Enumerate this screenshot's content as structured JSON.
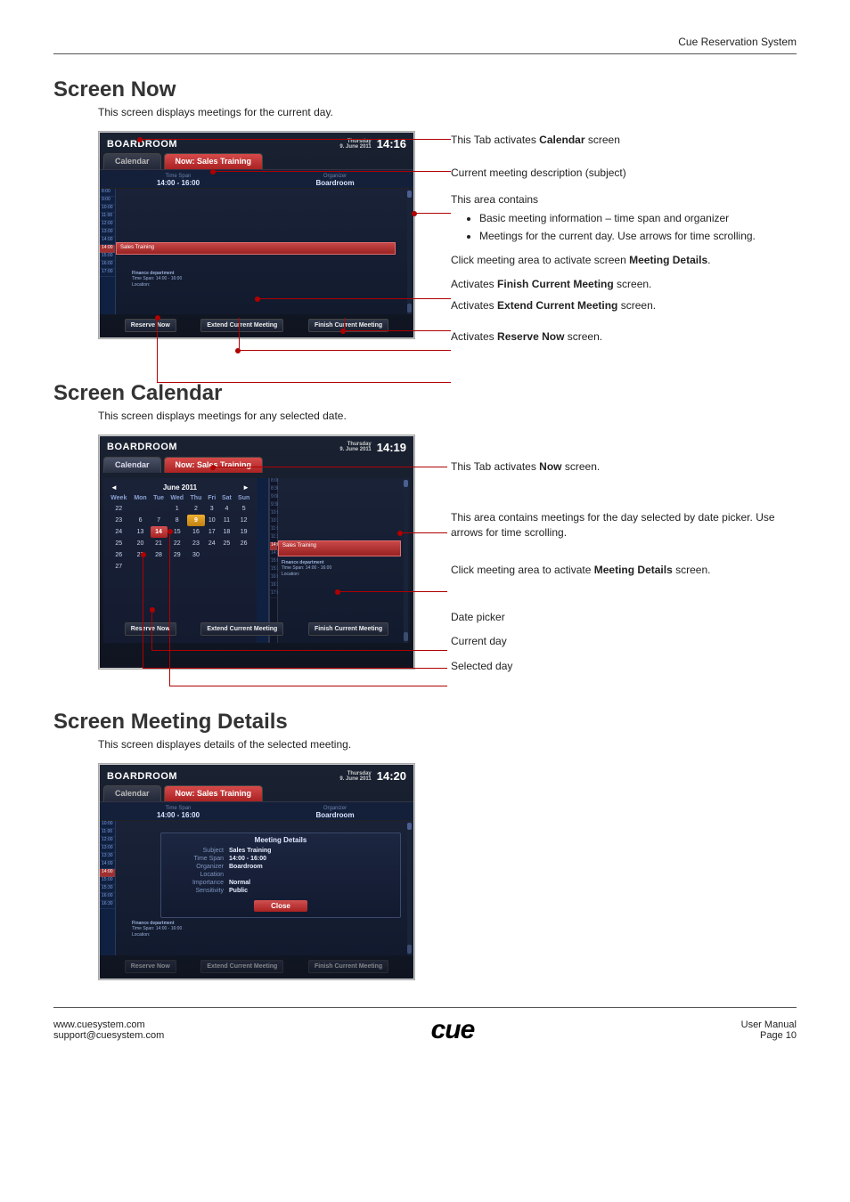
{
  "page": {
    "header_right": "Cue Reservation System",
    "footer_url": "www.cuesystem.com",
    "footer_email": "support@cuesystem.com",
    "footer_logo": "cue",
    "footer_manual": "User Manual",
    "footer_page": "Page 10"
  },
  "screen_now": {
    "heading": "Screen Now",
    "intro": "This screen displays meetings for the current day.",
    "room": "BOARDROOM",
    "date_line1": "Thursday",
    "date_line2": "9. June 2011",
    "clock": "14:16",
    "tab_left": "Calendar",
    "tab_right": "Now: Sales Training",
    "timespan_label": "Time Span",
    "timespan_value": "14:00 - 16:00",
    "organizer_label": "Organizer",
    "organizer_value": "Boardroom",
    "current_meeting_title": "Sales Training",
    "meeting_info_l1": "Finance department",
    "meeting_info_l2": "Time Span: 14:00 - 16:00",
    "meeting_info_l3": "Location:",
    "btn_reserve": "Reserve Now",
    "btn_extend": "Extend Current Meeting",
    "btn_finish": "Finish Current Meeting",
    "a1": "This Tab activates ",
    "a1b": "Calendar",
    "a1c": " screen",
    "a2": "Current meeting description  (subject)",
    "a3": "This area contains",
    "a3_li1": "Basic meeting information – time span and organizer",
    "a3_li2": "Meetings for the current day. Use arrows for time scrolling.",
    "a4a": "Click meeting area to activate screen ",
    "a4b": "Meeting Details",
    "a4c": ".",
    "a5a": "Activates ",
    "a5b": "Finish Current Meeting",
    "a5c": " screen.",
    "a6a": "Activates ",
    "a6b": "Extend Current Meeting",
    "a6c": " screen.",
    "a7a": "Activates ",
    "a7b": "Reserve Now",
    "a7c": " screen."
  },
  "screen_cal": {
    "heading": "Screen Calendar",
    "intro": "This screen displays meetings for any selected date.",
    "room": "BOARDROOM",
    "date_line1": "Thursday",
    "date_line2": "9. June 2011",
    "clock": "14:19",
    "tab_left": "Calendar",
    "tab_right": "Now: Sales Training",
    "month": "June 2011",
    "dow": [
      "Week",
      "Mon",
      "Tue",
      "Wed",
      "Thu",
      "Fri",
      "Sat",
      "Sun"
    ],
    "weeks": [
      [
        "22",
        "",
        "",
        "1",
        "2",
        "3",
        "4",
        "5"
      ],
      [
        "23",
        "6",
        "7",
        "8",
        "9",
        "10",
        "11",
        "12"
      ],
      [
        "24",
        "13",
        "14",
        "15",
        "16",
        "17",
        "18",
        "19"
      ],
      [
        "25",
        "20",
        "21",
        "22",
        "23",
        "24",
        "25",
        "26"
      ],
      [
        "26",
        "27",
        "28",
        "29",
        "30",
        "",
        "",
        ""
      ],
      [
        "27",
        "",
        "",
        "",
        "",
        "",
        "",
        ""
      ]
    ],
    "today_cell": "14",
    "selected_cell": "9",
    "current_meeting_title": "Sales Training",
    "meeting_info_l1": "Finance department",
    "meeting_info_l2": "Time Span: 14:00 - 16:00",
    "meeting_info_l3": "Location:",
    "btn_reserve": "Reserve Now",
    "btn_extend": "Extend Current Meeting",
    "btn_finish": "Finish Current Meeting",
    "a1a": "This Tab activates ",
    "a1b": "Now",
    "a1c": " screen.",
    "a2": "This area contains meetings for the day selected by date picker. Use arrows for time scrolling.",
    "a3a": "Click meeting area to activate ",
    "a3b": "Meeting Details",
    "a3c": " screen.",
    "a4": "Date picker",
    "a5": "Current day",
    "a6": "Selected day"
  },
  "screen_md": {
    "heading": "Screen Meeting Details",
    "intro": "This screen displayes details of the selected meeting.",
    "room": "BOARDROOM",
    "date_line1": "Thursday",
    "date_line2": "9. June 2011",
    "clock": "14:20",
    "tab_left": "Calendar",
    "tab_right": "Now: Sales Training",
    "timespan_label": "Time Span",
    "timespan_value": "14:00 - 16:00",
    "organizer_label": "Organizer",
    "organizer_value": "Boardroom",
    "modal_title": "Meeting Details",
    "rows": [
      {
        "l": "Subject",
        "v": "Sales Training"
      },
      {
        "l": "Time Span",
        "v": "14:00 - 16:00"
      },
      {
        "l": "Organizer",
        "v": "Boardroom"
      },
      {
        "l": "Location",
        "v": ""
      },
      {
        "l": "Importance",
        "v": "Normal"
      },
      {
        "l": "Sensitivity",
        "v": "Public"
      }
    ],
    "close": "Close",
    "btn_reserve": "Reserve Now",
    "btn_extend": "Extend Current Meeting",
    "btn_finish": "Finish Current Meeting"
  }
}
